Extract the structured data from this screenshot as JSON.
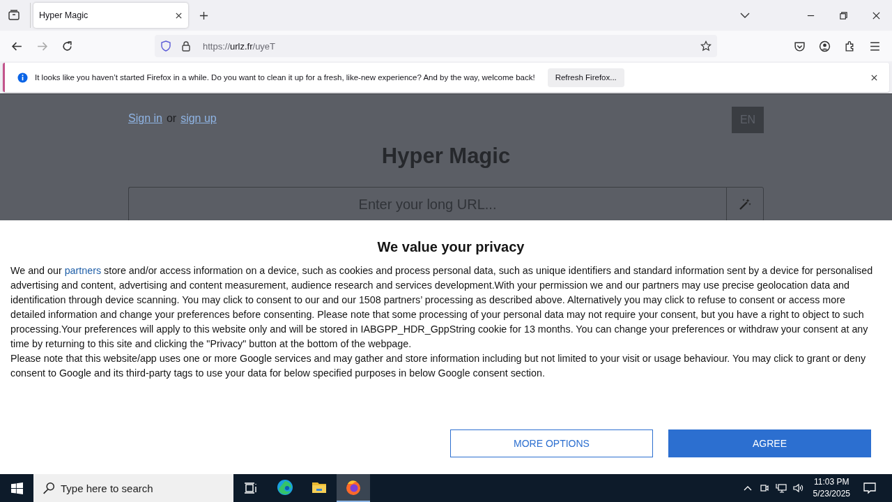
{
  "browser": {
    "tabs": [
      {
        "title": "Hyper Magic",
        "selected": true
      }
    ],
    "url": {
      "scheme": "https://",
      "host": "urlz.fr",
      "path": "/uyeT"
    },
    "notification": {
      "message": "It looks like you haven’t started Firefox in a while. Do you want to clean it up for a fresh, like-new experience? And by the way, welcome back!",
      "button": "Refresh Firefox..."
    }
  },
  "page": {
    "sign_in": "Sign in",
    "or": "or",
    "sign_up": "sign up",
    "language": "EN",
    "title": "Hyper Magic",
    "url_field": {
      "placeholder": "Enter your long URL..."
    }
  },
  "consent": {
    "title": "We value your privacy",
    "paragraphs": [
      {
        "before": "We and our ",
        "link": "partners",
        "after": " store and/or access information on a device, such as cookies and process personal data, such as unique identifiers and standard information sent by a device for personalised advertising and content, advertising and content measurement, audience research and services development.With your permission we and our partners may use precise geolocation data and identification through device scanning. You may click to consent to our and our 1508 partners’ processing as described above. Alternatively you may click to refuse to consent or access more detailed information and change your preferences before consenting. Please note that some processing of your personal data may not require your consent, but you have a right to object to such processing.Your preferences will apply to this website only and will be stored in IABGPP_HDR_GppString cookie for 13 months. You can change your preferences or withdraw your consent at any time by returning to this site and clicking the \"Privacy\" button at the bottom of the webpage."
      },
      {
        "before": "Please note that this website/app uses one or more Google services and may gather and store information including but not limited to your visit or usage behaviour. You may click to grant or deny consent to Google and its third-party tags to use your data for below specified purposes in below Google consent section."
      }
    ],
    "buttons": [
      {
        "label": "MORE OPTIONS",
        "kind": "outline"
      },
      {
        "label": "AGREE",
        "kind": "primary"
      }
    ]
  },
  "taskbar": {
    "search": {
      "placeholder": "Type here to search"
    },
    "apps": [
      {
        "kind": "taskview",
        "selected": false
      },
      {
        "kind": "edge",
        "selected": false
      },
      {
        "kind": "files",
        "selected": false
      },
      {
        "kind": "firefox",
        "selected": true
      }
    ],
    "time": "11:03 PM",
    "date": "5/23/2025"
  }
}
